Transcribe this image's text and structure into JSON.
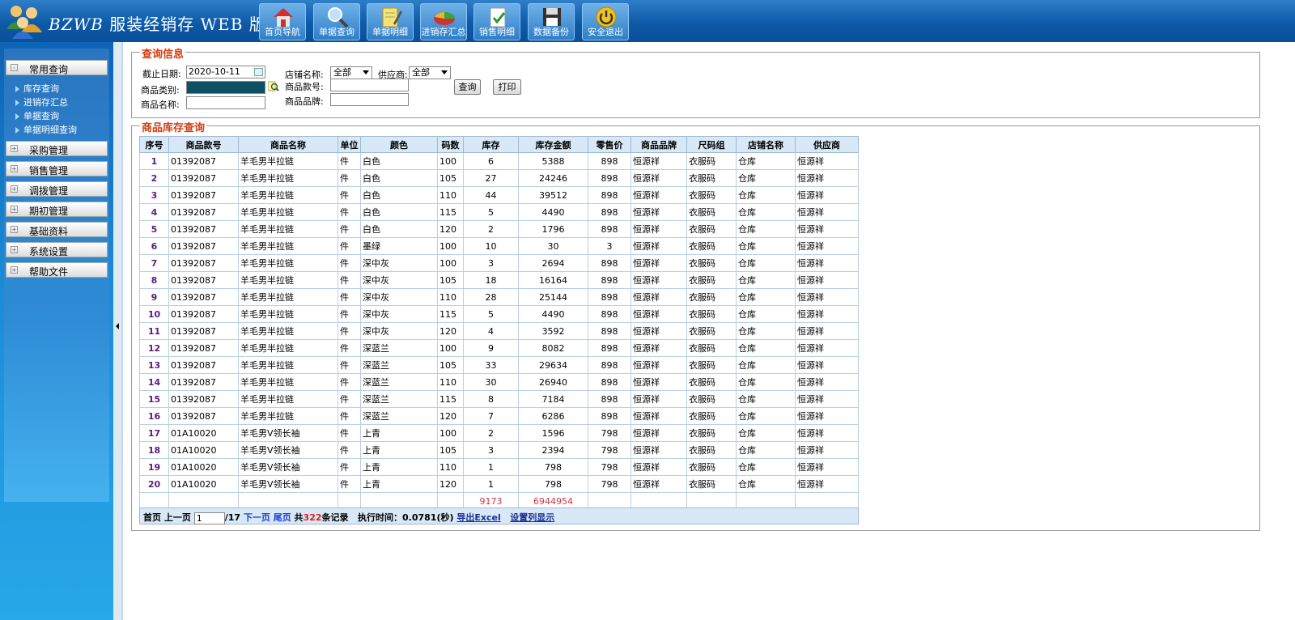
{
  "app": {
    "title_latin": "BZWB",
    "title_cn": "服装经销存 WEB 版"
  },
  "nav": [
    {
      "label": "首页导航",
      "icon": "home-icon"
    },
    {
      "label": "单据查询",
      "icon": "magnifier-icon"
    },
    {
      "label": "单据明细",
      "icon": "notepad-icon"
    },
    {
      "label": "进销存汇总",
      "icon": "pie-chart-icon"
    },
    {
      "label": "销售明细",
      "icon": "document-check-icon"
    },
    {
      "label": "数据备份",
      "icon": "floppy-disk-icon"
    },
    {
      "label": "安全退出",
      "icon": "power-icon"
    }
  ],
  "sidebar": {
    "groups": [
      {
        "label": "常用查询",
        "items": [
          "库存查询",
          "进销存汇总",
          "单据查询",
          "单据明细查询"
        ]
      },
      {
        "label": "采购管理"
      },
      {
        "label": "销售管理"
      },
      {
        "label": "调拨管理"
      },
      {
        "label": "期初管理"
      },
      {
        "label": "基础资料"
      },
      {
        "label": "系统设置"
      },
      {
        "label": "帮助文件"
      }
    ]
  },
  "query": {
    "legend": "查询信息",
    "date_label": "截止日期:",
    "date_value": "2020-10-11",
    "category_label": "商品类别:",
    "name_label": "商品名称:",
    "store_label": "店铺名称:",
    "store_value": "全部",
    "supplier_label": "供应商:",
    "supplier_value": "全部",
    "code_label": "商品款号:",
    "brand_label": "商品品牌:",
    "search_btn": "查询",
    "print_btn": "打印"
  },
  "results": {
    "legend": "商品库存查询",
    "columns": [
      "序号",
      "商品款号",
      "商品名称",
      "单位",
      "颜色",
      "码数",
      "库存",
      "库存金额",
      "零售价",
      "商品品牌",
      "尺码组",
      "店铺名称",
      "供应商"
    ],
    "rows": [
      [
        "1",
        "01392087",
        "羊毛男半拉链",
        "件",
        "白色",
        "100",
        "6",
        "5388",
        "898",
        "恒源祥",
        "衣服码",
        "仓库",
        "恒源祥"
      ],
      [
        "2",
        "01392087",
        "羊毛男半拉链",
        "件",
        "白色",
        "105",
        "27",
        "24246",
        "898",
        "恒源祥",
        "衣服码",
        "仓库",
        "恒源祥"
      ],
      [
        "3",
        "01392087",
        "羊毛男半拉链",
        "件",
        "白色",
        "110",
        "44",
        "39512",
        "898",
        "恒源祥",
        "衣服码",
        "仓库",
        "恒源祥"
      ],
      [
        "4",
        "01392087",
        "羊毛男半拉链",
        "件",
        "白色",
        "115",
        "5",
        "4490",
        "898",
        "恒源祥",
        "衣服码",
        "仓库",
        "恒源祥"
      ],
      [
        "5",
        "01392087",
        "羊毛男半拉链",
        "件",
        "白色",
        "120",
        "2",
        "1796",
        "898",
        "恒源祥",
        "衣服码",
        "仓库",
        "恒源祥"
      ],
      [
        "6",
        "01392087",
        "羊毛男半拉链",
        "件",
        "墨绿",
        "100",
        "10",
        "30",
        "3",
        "恒源祥",
        "衣服码",
        "仓库",
        "恒源祥"
      ],
      [
        "7",
        "01392087",
        "羊毛男半拉链",
        "件",
        "深中灰",
        "100",
        "3",
        "2694",
        "898",
        "恒源祥",
        "衣服码",
        "仓库",
        "恒源祥"
      ],
      [
        "8",
        "01392087",
        "羊毛男半拉链",
        "件",
        "深中灰",
        "105",
        "18",
        "16164",
        "898",
        "恒源祥",
        "衣服码",
        "仓库",
        "恒源祥"
      ],
      [
        "9",
        "01392087",
        "羊毛男半拉链",
        "件",
        "深中灰",
        "110",
        "28",
        "25144",
        "898",
        "恒源祥",
        "衣服码",
        "仓库",
        "恒源祥"
      ],
      [
        "10",
        "01392087",
        "羊毛男半拉链",
        "件",
        "深中灰",
        "115",
        "5",
        "4490",
        "898",
        "恒源祥",
        "衣服码",
        "仓库",
        "恒源祥"
      ],
      [
        "11",
        "01392087",
        "羊毛男半拉链",
        "件",
        "深中灰",
        "120",
        "4",
        "3592",
        "898",
        "恒源祥",
        "衣服码",
        "仓库",
        "恒源祥"
      ],
      [
        "12",
        "01392087",
        "羊毛男半拉链",
        "件",
        "深蓝兰",
        "100",
        "9",
        "8082",
        "898",
        "恒源祥",
        "衣服码",
        "仓库",
        "恒源祥"
      ],
      [
        "13",
        "01392087",
        "羊毛男半拉链",
        "件",
        "深蓝兰",
        "105",
        "33",
        "29634",
        "898",
        "恒源祥",
        "衣服码",
        "仓库",
        "恒源祥"
      ],
      [
        "14",
        "01392087",
        "羊毛男半拉链",
        "件",
        "深蓝兰",
        "110",
        "30",
        "26940",
        "898",
        "恒源祥",
        "衣服码",
        "仓库",
        "恒源祥"
      ],
      [
        "15",
        "01392087",
        "羊毛男半拉链",
        "件",
        "深蓝兰",
        "115",
        "8",
        "7184",
        "898",
        "恒源祥",
        "衣服码",
        "仓库",
        "恒源祥"
      ],
      [
        "16",
        "01392087",
        "羊毛男半拉链",
        "件",
        "深蓝兰",
        "120",
        "7",
        "6286",
        "898",
        "恒源祥",
        "衣服码",
        "仓库",
        "恒源祥"
      ],
      [
        "17",
        "01A10020",
        "羊毛男V领长袖",
        "件",
        "上青",
        "100",
        "2",
        "1596",
        "798",
        "恒源祥",
        "衣服码",
        "仓库",
        "恒源祥"
      ],
      [
        "18",
        "01A10020",
        "羊毛男V领长袖",
        "件",
        "上青",
        "105",
        "3",
        "2394",
        "798",
        "恒源祥",
        "衣服码",
        "仓库",
        "恒源祥"
      ],
      [
        "19",
        "01A10020",
        "羊毛男V领长袖",
        "件",
        "上青",
        "110",
        "1",
        "798",
        "798",
        "恒源祥",
        "衣服码",
        "仓库",
        "恒源祥"
      ],
      [
        "20",
        "01A10020",
        "羊毛男V领长袖",
        "件",
        "上青",
        "120",
        "1",
        "798",
        "798",
        "恒源祥",
        "衣服码",
        "仓库",
        "恒源祥"
      ]
    ],
    "totals": {
      "stock": "9173",
      "amount": "6944954"
    }
  },
  "pager": {
    "first": "首页",
    "prev": "上一页",
    "page_value": "1",
    "total_pages": "/17",
    "next": "下一页",
    "last": "尾页",
    "records_prefix": "共",
    "records_count": "322",
    "records_suffix": "条记录",
    "exec_time": "执行时间：0.0781(秒)",
    "export": "导出Excel",
    "columns_setting": "设置列显示"
  },
  "colors": {
    "header": "#0d5aa8",
    "legend": "#d33d12",
    "total": "#d6343c",
    "table_header": "#d8e8f6"
  }
}
